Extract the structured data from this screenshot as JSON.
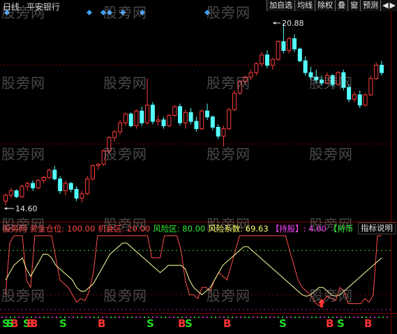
{
  "header": {
    "period": "日线",
    "stock_name": "平安银行"
  },
  "toolbar": {
    "items": [
      "加自选",
      "均线",
      "除权",
      "叠",
      "窗",
      "预测"
    ],
    "scroll_left_icon": "triangle-left-icon",
    "scroll_right_icon": "triangle-right-icon"
  },
  "price_chart": {
    "max_label": "20.88",
    "min_label": "14.60",
    "up_color": "#ff3c3c",
    "down_color": "#54ffff",
    "marker_color": "#3aa0ff"
  },
  "indicator": {
    "name": "股旁网",
    "fund_position_label": "资金仓位:",
    "fund_position_value": "100.00",
    "opportunity_label": "机会区:",
    "opportunity_value": "20.00",
    "risk_zone_label": "风险区:",
    "risk_zone_value": "80.00",
    "risk_coef_label": "风险系数:",
    "risk_coef_value": "69.63",
    "hold_label": "【持股】",
    "hold_value": "4.00",
    "cash_label": "【持币",
    "help_label": "指标说明",
    "line1_color": "#ff4d4d",
    "line2_color": "#ffff9a"
  },
  "signals": [
    {
      "text": "S",
      "color": "#22dd22"
    },
    {
      "text": "B",
      "color": "#ff3333"
    },
    {
      "text": "S",
      "color": "#22dd22"
    },
    {
      "text": "B",
      "color": "#ff3333"
    },
    {
      "text": "S",
      "color": "#22dd22"
    },
    {
      "text": "B",
      "color": "#ff3333"
    },
    {
      "text": "S",
      "color": "#22dd22"
    },
    {
      "text": "B",
      "color": "#ff3333"
    },
    {
      "text": "S",
      "color": "#22dd22"
    },
    {
      "text": "B",
      "color": "#ff3333"
    },
    {
      "text": "S",
      "color": "#22dd22"
    },
    {
      "text": "B",
      "color": "#ff3333"
    },
    {
      "text": "S",
      "color": "#22dd22"
    },
    {
      "text": "B",
      "color": "#ff3333"
    },
    {
      "text": "S",
      "color": "#22dd22"
    },
    {
      "text": "B",
      "color": "#ff3333"
    }
  ],
  "watermark": "股旁网",
  "chart_data": {
    "type": "candlestick",
    "min_price": 14.6,
    "max_price": 20.88,
    "candles": [
      [
        14.85,
        15.1,
        14.7,
        15.05
      ],
      [
        15.05,
        15.3,
        14.95,
        15.2
      ],
      [
        15.2,
        15.25,
        14.95,
        15.0
      ],
      [
        15.0,
        15.4,
        14.95,
        15.35
      ],
      [
        15.35,
        15.5,
        15.2,
        15.45
      ],
      [
        15.45,
        15.55,
        15.2,
        15.3
      ],
      [
        15.3,
        15.6,
        15.25,
        15.55
      ],
      [
        15.55,
        15.7,
        15.45,
        15.65
      ],
      [
        15.65,
        15.95,
        15.6,
        15.9
      ],
      [
        15.9,
        16.05,
        15.55,
        15.6
      ],
      [
        15.6,
        15.7,
        15.1,
        15.2
      ],
      [
        15.2,
        15.55,
        15.05,
        15.45
      ],
      [
        15.45,
        15.5,
        15.15,
        15.25
      ],
      [
        15.25,
        15.35,
        14.85,
        14.95
      ],
      [
        14.95,
        15.2,
        14.8,
        15.1
      ],
      [
        15.1,
        15.7,
        15.05,
        15.6
      ],
      [
        15.6,
        16.1,
        15.55,
        16.05
      ],
      [
        16.05,
        16.15,
        15.9,
        16.1
      ],
      [
        16.1,
        16.6,
        16.05,
        16.55
      ],
      [
        16.55,
        17.05,
        16.45,
        17.0
      ],
      [
        17.0,
        17.25,
        16.85,
        17.2
      ],
      [
        17.2,
        17.6,
        17.1,
        17.5
      ],
      [
        17.5,
        17.85,
        17.4,
        17.8
      ],
      [
        17.8,
        17.85,
        17.35,
        17.4
      ],
      [
        17.4,
        17.95,
        17.3,
        17.9
      ],
      [
        17.9,
        18.05,
        17.4,
        17.5
      ],
      [
        17.5,
        19.0,
        17.45,
        18.1
      ],
      [
        18.1,
        18.2,
        17.45,
        17.55
      ],
      [
        17.55,
        17.75,
        17.4,
        17.6
      ],
      [
        17.6,
        17.7,
        17.3,
        17.4
      ],
      [
        17.4,
        17.8,
        17.35,
        17.75
      ],
      [
        17.75,
        18.1,
        17.7,
        18.05
      ],
      [
        18.05,
        18.15,
        17.4,
        17.5
      ],
      [
        17.5,
        17.95,
        17.3,
        17.85
      ],
      [
        17.85,
        18.0,
        17.45,
        17.55
      ],
      [
        17.55,
        17.7,
        17.2,
        17.3
      ],
      [
        17.3,
        17.95,
        17.25,
        17.9
      ],
      [
        17.9,
        18.15,
        17.6,
        17.7
      ],
      [
        17.7,
        17.75,
        17.25,
        17.35
      ],
      [
        17.35,
        17.45,
        16.95,
        17.05
      ],
      [
        17.05,
        17.4,
        16.7,
        17.3
      ],
      [
        17.3,
        18.0,
        17.25,
        17.95
      ],
      [
        17.95,
        18.6,
        17.9,
        18.5
      ],
      [
        18.5,
        18.95,
        18.45,
        18.9
      ],
      [
        18.9,
        19.1,
        18.8,
        19.05
      ],
      [
        19.05,
        19.3,
        18.95,
        19.2
      ],
      [
        19.2,
        19.55,
        19.1,
        19.5
      ],
      [
        19.5,
        19.9,
        19.4,
        19.8
      ],
      [
        19.8,
        19.95,
        19.35,
        19.45
      ],
      [
        19.45,
        19.7,
        19.3,
        19.65
      ],
      [
        19.65,
        20.3,
        19.6,
        20.25
      ],
      [
        20.25,
        20.88,
        19.85,
        19.95
      ],
      [
        19.95,
        20.4,
        19.85,
        20.35
      ],
      [
        20.35,
        20.5,
        19.9,
        20.0
      ],
      [
        20.0,
        20.05,
        19.55,
        19.6
      ],
      [
        19.6,
        19.75,
        19.1,
        19.2
      ],
      [
        19.2,
        19.4,
        18.95,
        19.05
      ],
      [
        19.05,
        19.3,
        18.85,
        18.95
      ],
      [
        18.95,
        19.1,
        18.75,
        18.85
      ],
      [
        18.85,
        19.2,
        18.8,
        19.1
      ],
      [
        19.1,
        19.15,
        18.7,
        18.8
      ],
      [
        18.8,
        19.25,
        18.75,
        19.2
      ],
      [
        19.2,
        19.3,
        18.6,
        18.7
      ],
      [
        18.7,
        18.8,
        18.2,
        18.3
      ],
      [
        18.3,
        18.55,
        18.2,
        18.45
      ],
      [
        18.45,
        18.6,
        18.0,
        18.1
      ],
      [
        18.1,
        18.5,
        18.05,
        18.45
      ],
      [
        18.45,
        19.1,
        18.4,
        19.0
      ],
      [
        19.0,
        19.55,
        18.95,
        19.45
      ],
      [
        19.45,
        19.6,
        19.1,
        19.2
      ]
    ],
    "indicator_series": [
      {
        "name": "line1",
        "values": [
          20,
          90,
          100,
          100,
          100,
          40,
          30,
          100,
          100,
          100,
          100,
          100,
          70,
          40,
          35,
          30,
          20,
          10,
          15,
          12,
          25,
          50,
          100,
          100,
          100,
          100,
          100,
          100,
          100,
          100,
          100,
          100,
          100,
          100,
          100,
          70,
          70,
          70,
          100,
          100,
          100,
          100,
          80,
          40,
          20,
          20,
          15,
          30,
          30,
          25,
          40,
          50,
          45,
          40,
          60,
          80,
          100,
          100,
          100,
          100,
          100,
          100,
          100,
          100,
          100,
          100,
          100,
          100,
          80,
          60,
          40,
          30,
          25,
          20,
          10,
          5,
          12,
          18,
          15,
          12,
          30,
          25,
          8,
          8,
          8,
          8,
          15,
          10,
          20,
          100,
          100
        ]
      },
      {
        "name": "line2",
        "values": [
          40,
          50,
          60,
          65,
          70,
          55,
          45,
          55,
          65,
          75,
          75,
          70,
          60,
          55,
          50,
          45,
          40,
          30,
          25,
          25,
          30,
          35,
          45,
          55,
          65,
          75,
          80,
          85,
          90,
          90,
          85,
          80,
          75,
          70,
          65,
          60,
          55,
          50,
          55,
          60,
          60,
          60,
          60,
          55,
          40,
          30,
          25,
          20,
          25,
          30,
          40,
          50,
          60,
          65,
          70,
          75,
          80,
          85,
          85,
          80,
          75,
          70,
          65,
          60,
          55,
          50,
          45,
          40,
          35,
          30,
          25,
          20,
          18,
          20,
          25,
          30,
          30,
          25,
          20,
          18,
          20,
          25,
          30,
          35,
          40,
          45,
          50,
          55,
          60,
          65,
          70
        ]
      }
    ],
    "opportunity_level": 20,
    "risk_level": 80
  }
}
